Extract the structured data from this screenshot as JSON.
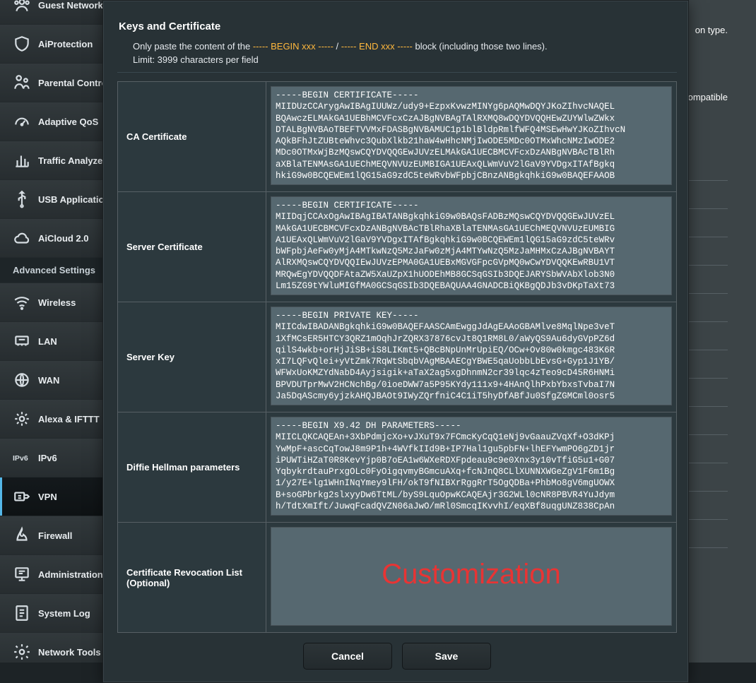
{
  "sidebar": {
    "section_advanced": "Advanced Settings",
    "items": [
      {
        "label": "Guest Network"
      },
      {
        "label": "AiProtection"
      },
      {
        "label": "Parental Controls"
      },
      {
        "label": "Adaptive QoS"
      },
      {
        "label": "Traffic Analyzer"
      },
      {
        "label": "USB Application"
      },
      {
        "label": "AiCloud 2.0"
      }
    ],
    "adv": [
      {
        "label": "Wireless"
      },
      {
        "label": "LAN"
      },
      {
        "label": "WAN"
      },
      {
        "label": "Alexa & IFTTT"
      },
      {
        "label": "IPv6"
      },
      {
        "label": "VPN"
      },
      {
        "label": "Firewall"
      },
      {
        "label": "Administration"
      },
      {
        "label": "System Log"
      },
      {
        "label": "Network Tools"
      }
    ]
  },
  "background": {
    "text1": "on type.",
    "text2": "e compatible"
  },
  "modal": {
    "title": "Keys and Certificate",
    "hint_prefix": "Only paste the content of the ",
    "hint_begin": "----- BEGIN xxx -----",
    "hint_sep": " / ",
    "hint_end": "----- END xxx -----",
    "hint_suffix": " block (including those two lines).",
    "hint_limit": "Limit: 3999 characters per field",
    "labels": {
      "ca": "CA Certificate",
      "server_cert": "Server Certificate",
      "server_key": "Server Key",
      "dh": "Diffie Hellman parameters",
      "crl": "Certificate Revocation List (Optional)"
    },
    "values": {
      "ca": "-----BEGIN CERTIFICATE-----\nMIIDUzCCArygAwIBAgIUUWz/udy9+EzpxKvwzMINYg6pAQMwDQYJKoZIhvcNAQEL\nBQAwczELMAkGA1UEBhMCVFcxCzAJBgNVBAgTAlRXMQ8wDQYDVQQHEwZUYWlwZWkx\nDTALBgNVBAoTBEFTVVMxFDASBgNVBAMUC1p1blBldpRmlfWFQ4MSEwHwYJKoZIhvcN\nAQkBFhJtZUBteWhvc3QubXlkb21haW4wHhcNMjIwODE5MDc0OTMxWhcNMzIwODE2\nMDc0OTMxWjBzMQswCQYDVQQGEwJUVzELMAkGA1UECBMCVFcxDzANBgNVBAcTBlRh\naXBlaTENMAsGA1UEChMEQVNVUzEUMBIGA1UEAxQLWmVuV2lGaV9YVDgxITAfBgkq\nhkiG9w0BCQEWEm1lQG15aG9zdC5teWRvbWFpbjCBnzANBgkqhkiG9w0BAQEFAAOB",
      "server_cert": "-----BEGIN CERTIFICATE-----\nMIIDqjCCAxOgAwIBAgIBATANBgkqhkiG9w0BAQsFADBzMQswCQYDVQQGEwJUVzEL\nMAkGA1UECBMCVFcxDzANBgNVBAcTBlRhaXBlaTENMAsGA1UEChMEQVNVUzEUMBIG\nA1UEAxQLWmVuV2lGaV9YVDgxITAfBgkqhkiG9w0BCQEWEm1lQG15aG9zdC5teWRv\nbWFpbjAeFw0yMjA4MTkwNzQ5MzJaFw0zMjA4MTYwNzQ5MzJaMHMxCzAJBgNVBAYT\nAlRXMQswCQYDVQQIEwJUVzEPMA0GA1UEBxMGVGFpcGVpMQ0wCwYDVQQKEwRBU1VT\nMRQwEgYDVQQDFAtaZW5XaUZpX1hUODEhMB8GCSqGSIb3DQEJARYSbWVAbXlob3N0\nLm15ZG9tYWluMIGfMA0GCSqGSIb3DQEBAQUAA4GNADCBiQKBgQDJb3vDKpTaXt73",
      "server_key": "-----BEGIN PRIVATE KEY-----\nMIICdwIBADANBgkqhkiG9w0BAQEFAASCAmEwggJdAgEAAoGBAMlve8MqlNpe3veT\n1XfMCsER5HTCY3QRZ1mOqhJrZQRX37876cvJt8Q1RM8L0/aWyQS9Au6dyGVpPZ6d\nqilS4wkb+orHjJiSB+iS8LIKmt5+QBcBNpUnMrUpiEQ/OCw+Ov80w0kmgc483K6R\nxI7LQFvQlei+yVtZmk7RqWtSbqbVAgMBAAECgYBWE5qaUobbLbEvsG+Gyp1J1YB/\nWFWxUoKMZYdNabD4Ayjsigik+aTaX2ag5xgDhnmN2cr39lqc4zTeo9cD45R6HNMi\nBPVDUTprMwV2HCNchBg/0ioeDWW7a5P95KYdy111x9+4HAnQlhPxbYbxsTvbaI7N\nJa5DqAScmy6yjzkAHQJBAOt9IWyZQrfniC4C1iT5hyDfABfJu0SfgZGMCml0osr5",
      "dh": "-----BEGIN X9.42 DH PARAMETERS-----\nMIICLQKCAQEAn+3XbPdmjcXo+vJXuT9x7FCmcKyCqQ1eNj9vGaauZVqXf+O3dKPj\nYwMpF+ascCqTowJ8m9P1h+4WVfkIId9B+IP7Hal1gu5pbFN+lhEFYwmPO6gZD1jr\niPUWTiHZaT0R8KevYjp0B7oEA1w6WXeRDXFpdeau9c9e0Xnx3y10vTfiG5u1+G07\nYqbykrdtauPrxgOLc0FyOigqvmyBGmcuAXq+fcNJnQ8CLlXUNNXWGeZgV1F6m1Bg\n1/y27E+lg1WHnINqYmey9lFH/okT9fNIBXrRggRrT5OgQDBa+PhbMo8gV6mgUOWX\nB+soGPbrkg2slxyyDw6TtML/byS9LquOpwKCAQEAjr3G2WLl0cNR8PBVR4YuJdym\nh/TdtXmIft/JuwqFcadQVZN06aJwO/mRl0SmcqIKvvhI/eqXBf8uqgUNZ838CpAn",
      "crl": "Customization"
    },
    "buttons": {
      "cancel": "Cancel",
      "save": "Save"
    }
  }
}
